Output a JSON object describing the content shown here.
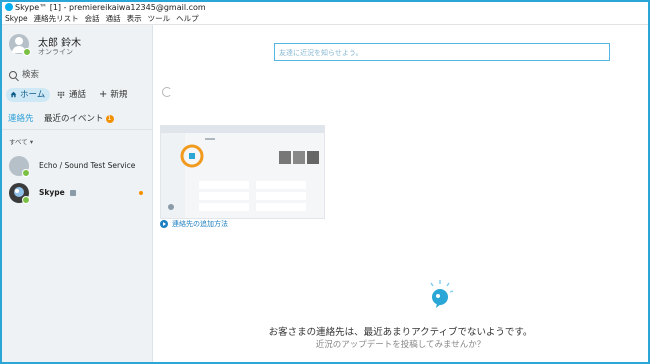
{
  "window": {
    "title": "Skype™ [1] - premiereikaiwa12345@gmail.com"
  },
  "menu": [
    "Skype",
    "連絡先リスト",
    "会話",
    "通話",
    "表示",
    "ツール",
    "ヘルプ"
  ],
  "profile": {
    "name": "太郎 鈴木",
    "status": "オンライン"
  },
  "search": {
    "label": "検索"
  },
  "nav": {
    "home": "ホーム",
    "calls": "通話",
    "new": "新規"
  },
  "tabs": {
    "contacts": "連絡先",
    "recent": "最近のイベント",
    "recent_badge": "1"
  },
  "filter": {
    "label": "すべて ▾"
  },
  "contacts": [
    {
      "name": "Echo / Sound Test Service"
    },
    {
      "name": "Skype"
    }
  ],
  "main": {
    "compose_placeholder": "友達に近況を知らせよう。",
    "howto_link": "連絡先の追加方法",
    "empty_message": "お客さまの連絡先は、最近あまりアクティブでないようです。",
    "empty_submessage": "近況のアップデートを投稿してみませんか？"
  },
  "colors": {
    "accent": "#00aff0",
    "online": "#7ac143",
    "badge": "#f29100",
    "link": "#1b7fc1",
    "frame": "#2aa7d6"
  }
}
